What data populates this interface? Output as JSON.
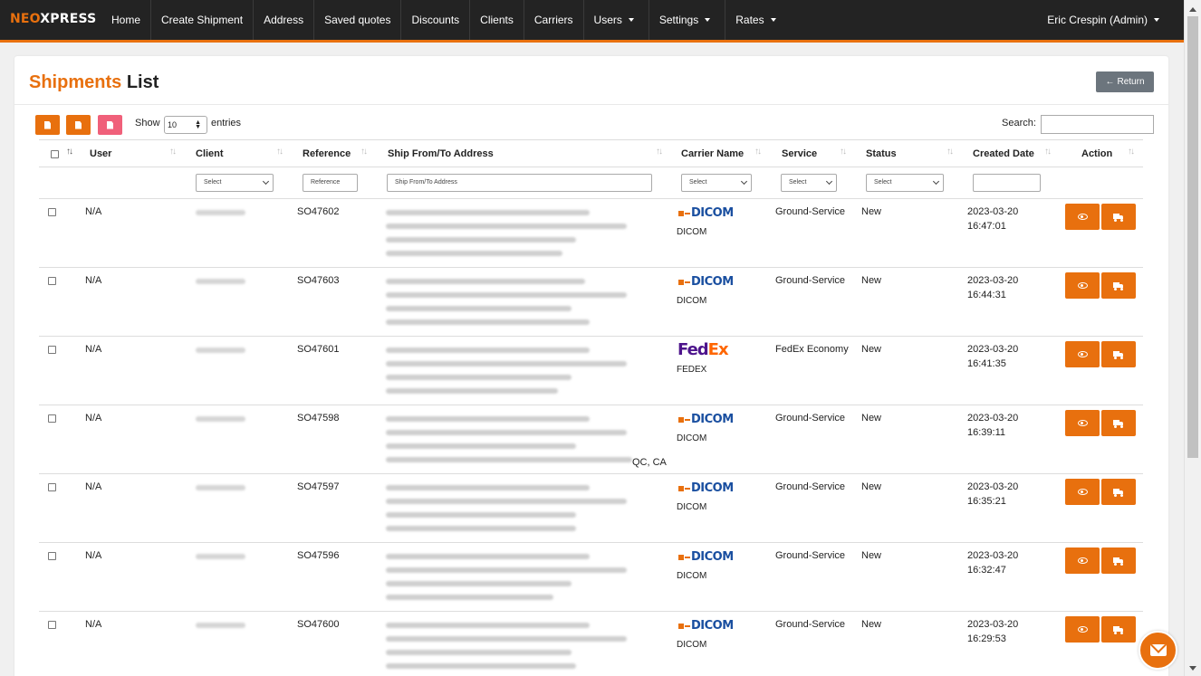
{
  "nav": {
    "brand_neo": "NEO",
    "brand_xpress": "XPRESS",
    "items": [
      {
        "label": "Home"
      },
      {
        "label": "Create Shipment"
      },
      {
        "label": "Address"
      },
      {
        "label": "Saved quotes"
      },
      {
        "label": "Discounts"
      },
      {
        "label": "Clients"
      },
      {
        "label": "Carriers"
      },
      {
        "label": "Users"
      },
      {
        "label": "Settings"
      },
      {
        "label": "Rates"
      }
    ],
    "user": "Eric Crespin (Admin)"
  },
  "page": {
    "title_orange": "Shipments",
    "title_dark": "List",
    "return_label": "Return"
  },
  "controls": {
    "show_label": "Show",
    "page_length": "10",
    "entries_label": "entries",
    "search_label": "Search:"
  },
  "table": {
    "headers": {
      "user": "User",
      "client": "Client",
      "reference": "Reference",
      "address": "Ship From/To Address",
      "carrier": "Carrier Name",
      "service": "Service",
      "status": "Status",
      "created": "Created Date",
      "action": "Action"
    },
    "filters": {
      "client": "Select",
      "reference": "Reference",
      "address": "Ship From/To Address",
      "carrier": "Select",
      "service": "Select",
      "status": "Select"
    },
    "rows": [
      {
        "user": "N/A",
        "reference": "SO47602",
        "carrier": "DICOM",
        "service": "Ground-Service",
        "status": "New",
        "date": "2023-03-20",
        "time": "16:47:01",
        "address_suffix": ""
      },
      {
        "user": "N/A",
        "reference": "SO47603",
        "carrier": "DICOM",
        "service": "Ground-Service",
        "status": "New",
        "date": "2023-03-20",
        "time": "16:44:31",
        "address_suffix": ""
      },
      {
        "user": "N/A",
        "reference": "SO47601",
        "carrier": "FEDEX",
        "service": "FedEx Economy",
        "status": "New",
        "date": "2023-03-20",
        "time": "16:41:35",
        "address_suffix": ""
      },
      {
        "user": "N/A",
        "reference": "SO47598",
        "carrier": "DICOM",
        "service": "Ground-Service",
        "status": "New",
        "date": "2023-03-20",
        "time": "16:39:11",
        "address_suffix": "QC, CA"
      },
      {
        "user": "N/A",
        "reference": "SO47597",
        "carrier": "DICOM",
        "service": "Ground-Service",
        "status": "New",
        "date": "2023-03-20",
        "time": "16:35:21",
        "address_suffix": ""
      },
      {
        "user": "N/A",
        "reference": "SO47596",
        "carrier": "DICOM",
        "service": "Ground-Service",
        "status": "New",
        "date": "2023-03-20",
        "time": "16:32:47",
        "address_suffix": ""
      },
      {
        "user": "N/A",
        "reference": "SO47600",
        "carrier": "DICOM",
        "service": "Ground-Service",
        "status": "New",
        "date": "2023-03-20",
        "time": "16:29:53",
        "address_suffix": ""
      }
    ]
  },
  "logos": {
    "dicom": "DICOM",
    "fedex_fed": "Fed",
    "fedex_ex": "Ex"
  },
  "colors": {
    "accent": "#e8700e",
    "navbar": "#232323",
    "pdf": "#f0607a",
    "dicom_blue": "#1a4fa0",
    "fedex_purple": "#4d148c"
  }
}
